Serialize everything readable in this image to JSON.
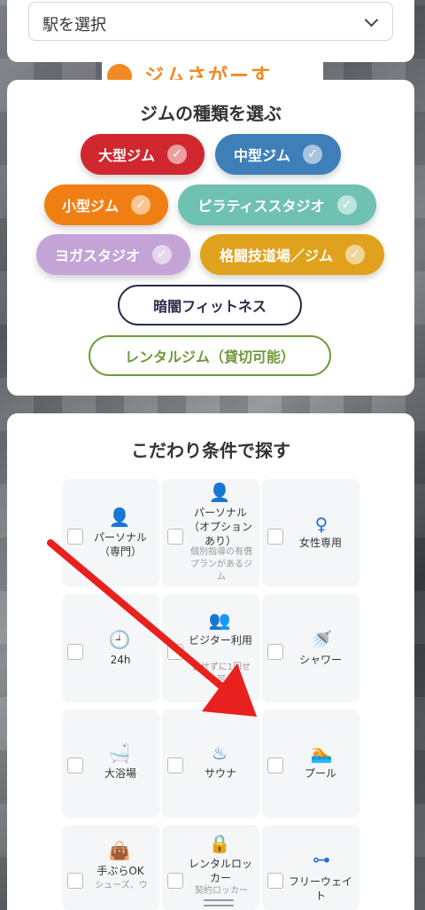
{
  "station": {
    "select_text": "駅を選択"
  },
  "banner": {
    "logo_text": "ジムさがーす"
  },
  "gym_types": {
    "title": "ジムの種類を選ぶ",
    "check_mark": "✓",
    "items": [
      {
        "label": "大型ジム",
        "color": "#d0282e",
        "checked": true
      },
      {
        "label": "中型ジム",
        "color": "#3f7fb9",
        "checked": true
      },
      {
        "label": "小型ジム",
        "color": "#f07f13",
        "checked": true
      },
      {
        "label": "ピラティススタジオ",
        "color": "#6fc1b2",
        "checked": true
      },
      {
        "label": "ヨガスタジオ",
        "color": "#c4a4d6",
        "checked": true
      },
      {
        "label": "格闘技道場／ジム",
        "color": "#e0a21c",
        "checked": true
      },
      {
        "label": "暗闇フィットネス",
        "color": "#2a2a4a",
        "checked": false
      },
      {
        "label": "レンタルジム（貸切可能）",
        "color": "#6f9a3a",
        "checked": false
      }
    ]
  },
  "conditions": {
    "title": "こだわり条件で探す",
    "items": [
      {
        "label": "パーソナル（専門）",
        "icon": "person-check-icon",
        "glyph": "👤"
      },
      {
        "label": "パーソナル（オプションあり）",
        "sub": "個別指導の有償プランがあるジム",
        "icon": "person-plus-icon",
        "glyph": "👤"
      },
      {
        "label": "女性専用",
        "icon": "female-icon",
        "glyph": "♀"
      },
      {
        "label": "24h",
        "icon": "clock-icon",
        "glyph": "🕘"
      },
      {
        "label": "ビジター利用",
        "sub": "会せずに1回せ可",
        "icon": "users-icon",
        "glyph": "👥"
      },
      {
        "label": "シャワー",
        "icon": "shower-icon",
        "glyph": "🚿"
      },
      {
        "label": "大浴場",
        "icon": "bath-icon",
        "glyph": "🛁"
      },
      {
        "label": "サウナ",
        "icon": "sauna-icon",
        "glyph": "♨"
      },
      {
        "label": "プール",
        "icon": "pool-icon",
        "glyph": "🏊"
      },
      {
        "label": "手ぶらOK",
        "sub": "シューズ、ウ",
        "icon": "bag-icon",
        "glyph": "👜"
      },
      {
        "label": "レンタルロッカー",
        "sub": "契約ロッカー",
        "icon": "lock-icon",
        "glyph": "🔒"
      },
      {
        "label": "フリーウェイト",
        "icon": "dumbbell-icon",
        "glyph": "⊶"
      }
    ]
  },
  "colors": {
    "arrow": "#e8211e",
    "condition_icon": "#1f6fe0"
  }
}
